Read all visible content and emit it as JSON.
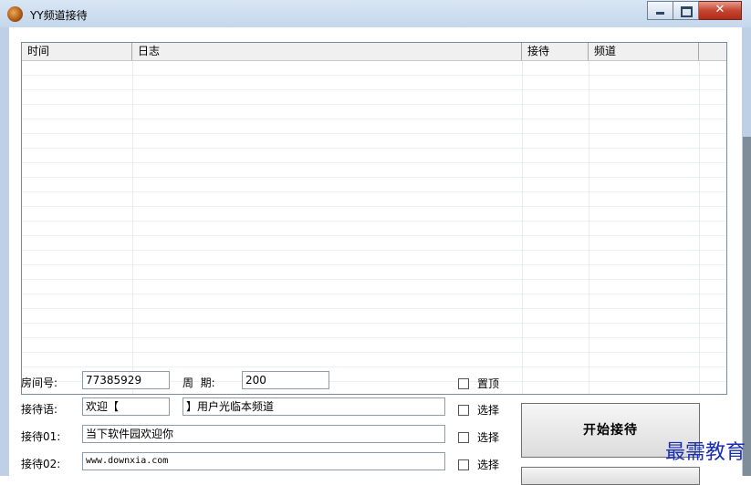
{
  "window": {
    "title": "YY频道接待",
    "controls": {
      "minimize": "minimize",
      "maximize": "maximize",
      "close": "close"
    }
  },
  "log_table": {
    "columns": [
      "时间",
      "日志",
      "接待",
      "频道"
    ],
    "rows": []
  },
  "form": {
    "room_label": "房间号:",
    "room_value": "77385929",
    "period_label": "周  期:",
    "period_value": "200",
    "pin_top_label": "置顶",
    "greeting_label": "接待语:",
    "greeting_prefix": "欢迎【",
    "greeting_suffix": "】用户光临本频道",
    "select_label_1": "选择",
    "greeting01_label": "接待01:",
    "greeting01_value": "当下软件园欢迎你",
    "select_label_2": "选择",
    "greeting02_label": "接待02:",
    "greeting02_value": "www.downxia.com",
    "select_label_3": "选择"
  },
  "start_button": "开始接待",
  "watermark": "最需教育",
  "colors": {
    "frame": "#bdd0e6",
    "close_button": "#c44732",
    "watermark": "#1a2fb0"
  }
}
